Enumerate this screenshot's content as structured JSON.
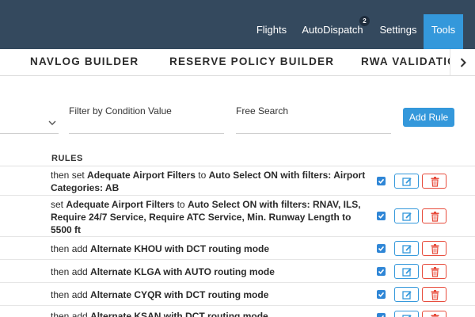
{
  "navbar": {
    "items": [
      {
        "label": "Flights"
      },
      {
        "label": "AutoDispatch",
        "badge": "2"
      },
      {
        "label": "Settings"
      },
      {
        "label": "Tools",
        "active": true
      }
    ]
  },
  "subtabs": {
    "items": [
      {
        "label": "NAVLOG BUILDER"
      },
      {
        "label": "RESERVE POLICY BUILDER"
      },
      {
        "label": "RWA VALIDATIO"
      }
    ],
    "scroll_icon": "chevron-right-icon"
  },
  "filters": {
    "condition_label": "Filter by Condition Value",
    "search_label": "Free Search",
    "add_rule_label": "Add Rule"
  },
  "rules": {
    "header": "RULES",
    "rows": [
      {
        "p1": "then set ",
        "b1": "Adequate Airport Filters",
        "p2": " to ",
        "b2": "Auto Select ON with filters: Airport Categories: AB",
        "checked": true
      },
      {
        "p1": "set ",
        "b1": "Adequate Airport Filters",
        "p2": " to ",
        "b2": "Auto Select ON with filters: RNAV, ILS, Require 24/7 Service, Require ATC Service, Min. Runway Length to 5500 ft",
        "checked": true
      },
      {
        "p1": "then add ",
        "b1": "Alternate KHOU with DCT routing mode",
        "checked": true
      },
      {
        "p1": "then add ",
        "b1": "Alternate KLGA with AUTO routing mode",
        "checked": true
      },
      {
        "p1": "then add ",
        "b1": "Alternate CYQR with DCT routing mode",
        "checked": true
      },
      {
        "p1": "then add ",
        "b1": "Alternate KSAN with DCT routing mode",
        "checked": true
      }
    ]
  },
  "colors": {
    "navbar_bg": "#34495e",
    "active_tab": "#3498db",
    "edit_border": "#3498db",
    "delete_border": "#e74c3c"
  }
}
